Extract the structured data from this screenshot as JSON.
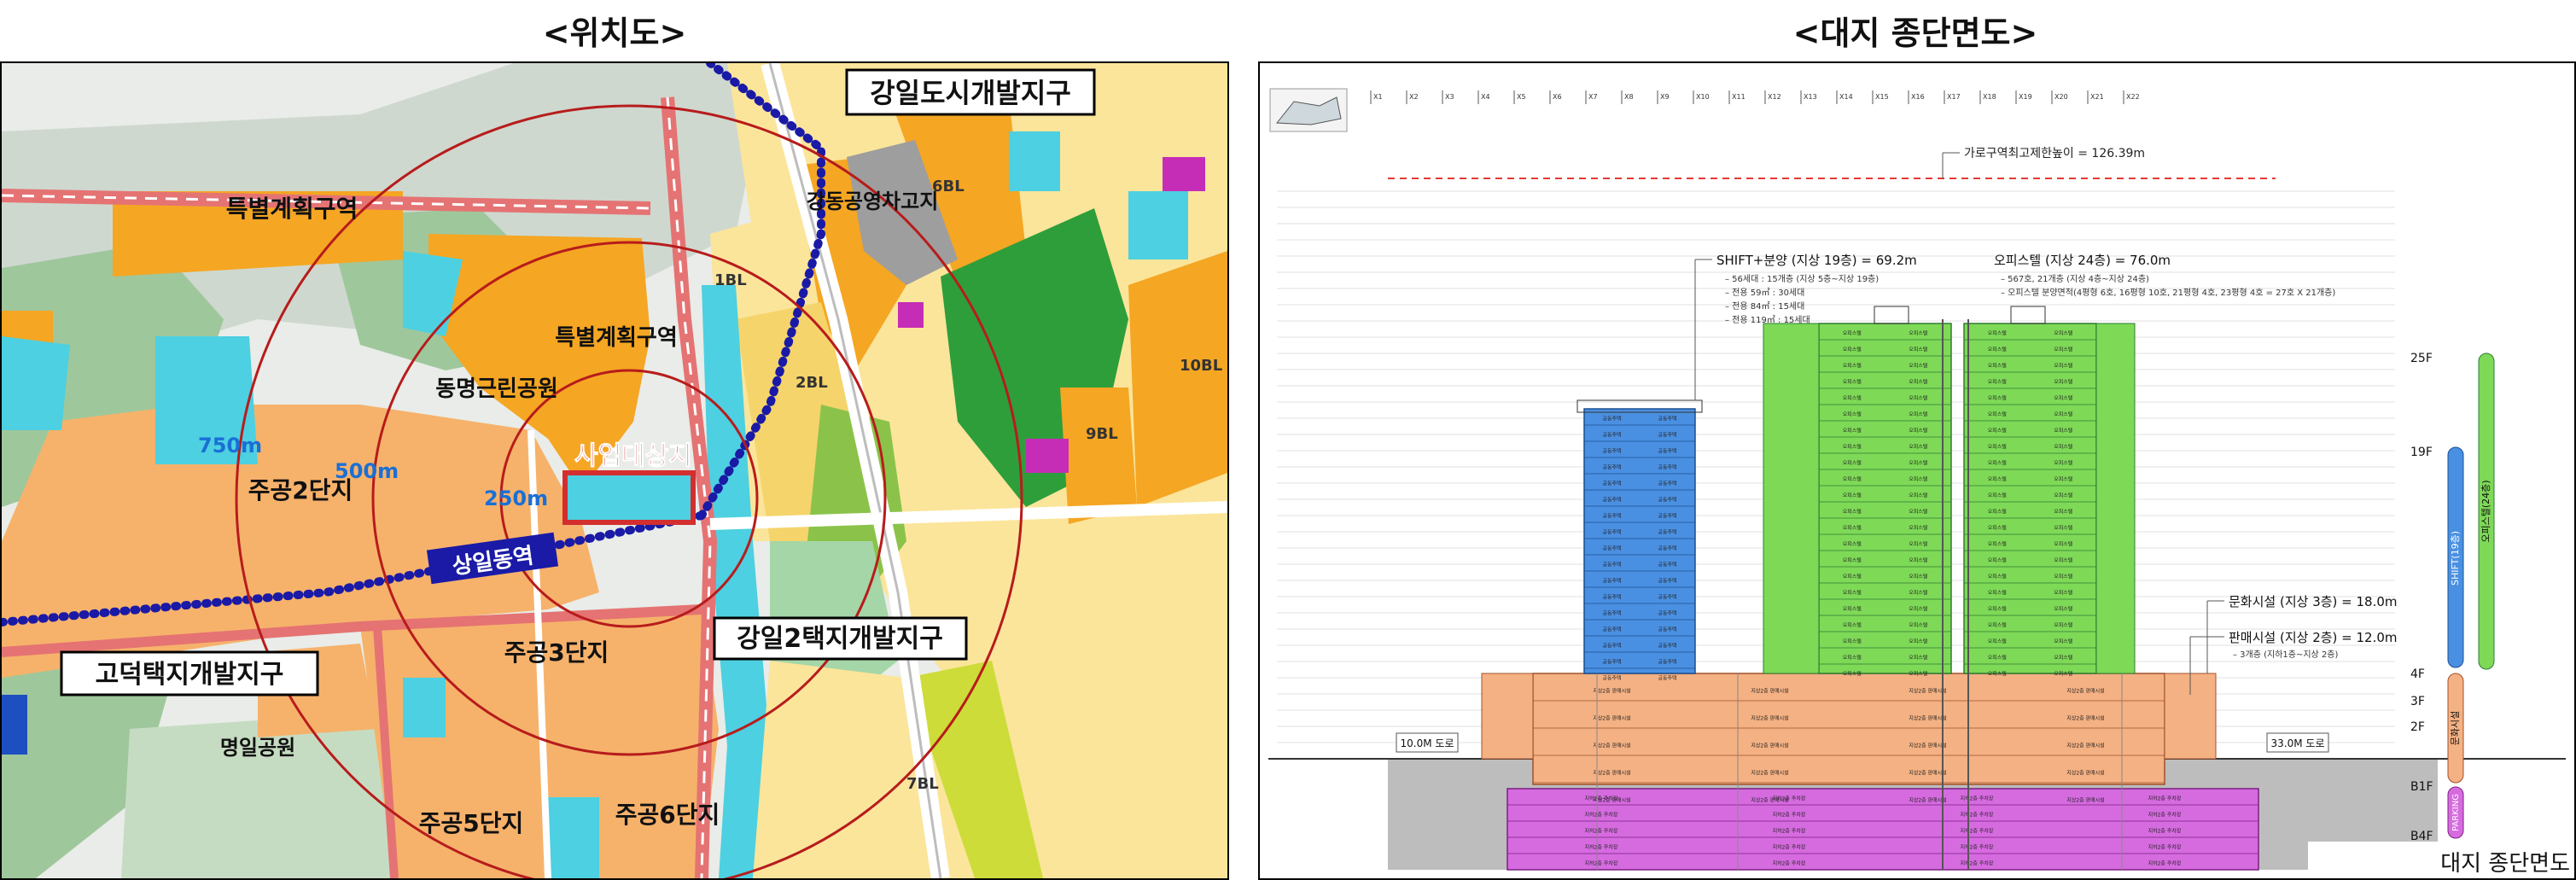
{
  "left_panel": {
    "title": "<위치도>",
    "labels": {
      "gangil_urban": "강일도시개발지구",
      "gangdong_garage": "강동공영차고지",
      "special_zone_1": "특별계획구역",
      "special_zone_2": "특별계획구역",
      "dongmyeong_park": "동명근린공원",
      "target_site": "사업대상지",
      "jugong2": "주공2단지",
      "jugong3": "주공3단지",
      "jugong5": "주공5단지",
      "jugong6": "주공6단지",
      "sangil_station": "상일동역",
      "godeok_district": "고덕택지개발지구",
      "gangil2_district": "강일2택지개발지구",
      "myeongil_park": "명일공원",
      "r750": "750m",
      "r500": "500m",
      "r250": "250m",
      "bl1": "1BL",
      "bl2": "2BL",
      "bl6": "6BL",
      "bl7": "7BL",
      "bl9": "9BL",
      "bl10": "10BL"
    },
    "colors": {
      "residential": "#f6b26b",
      "commercial": "#f5a623",
      "park": "#4caf50",
      "green_light": "#a5d6a7",
      "water": "#4dd0e1",
      "road_red": "#d32f2f",
      "rail_blue": "#1a1aa6",
      "ring": "#b71c1c",
      "purple": "#c62db6"
    }
  },
  "right_panel": {
    "title": "<대지 종단면도>",
    "caption": "대지 종단면도",
    "height_limit": "가로구역최고제한높이 = 126.39m",
    "shift_label": "SHIFT+분양 (지상 19층) = 69.2m",
    "shift_notes": [
      "– 56세대 : 15개층 (지상 5층~지상 19층)",
      "– 전용 59㎡ : 30세대",
      "– 전용 84㎡ : 15세대",
      "– 전용 119㎡ : 15세대"
    ],
    "office_label": "오피스텔 (지상 24층) = 76.0m",
    "office_notes": [
      "– 567호, 21개층 (지상 4층~지상 24층)",
      "– 오피스텔 분양면적(4평형 6호, 16평형 10호, 21평형 4호, 23평형 4호 = 27호 X 21개층)"
    ],
    "culture_label": "문화시설 (지상 3층) = 18.0m",
    "retail_label": "판매시설 (지상 2층) = 12.0m",
    "retail_note": "– 3개층 (지하1층~지상 2층)",
    "road_left": "10.0M 도로",
    "road_right": "33.0M 도로",
    "floor_markers": [
      "25F",
      "19F",
      "4F",
      "3F",
      "2F",
      "B1F",
      "B4F"
    ],
    "side_bars": {
      "shift": "SHIFT(19층)",
      "office": "오피스텔(24층)",
      "culture": "문화시설",
      "parking": "PARKING"
    },
    "unit_text": {
      "shift_unit": "공동주택",
      "office_unit": "오피스텔",
      "retail_unit": "지상2층 판매시설",
      "parking_unit": "지하2층 주차장"
    },
    "grid_labels": [
      "X1",
      "X2",
      "X3",
      "X4",
      "X5",
      "X6",
      "X7",
      "X8",
      "X9",
      "X10",
      "X11",
      "X12",
      "X13",
      "X14",
      "X15",
      "X16",
      "X17",
      "X18",
      "X19",
      "X20",
      "X21",
      "X22"
    ],
    "colors": {
      "shift_blue": "#4a90e2",
      "office_green": "#7ed957",
      "retail_orange": "#f4b183",
      "parking_purple": "#d66be0",
      "ground_gray": "#bdbdbd",
      "limit_red": "#e53935"
    }
  }
}
